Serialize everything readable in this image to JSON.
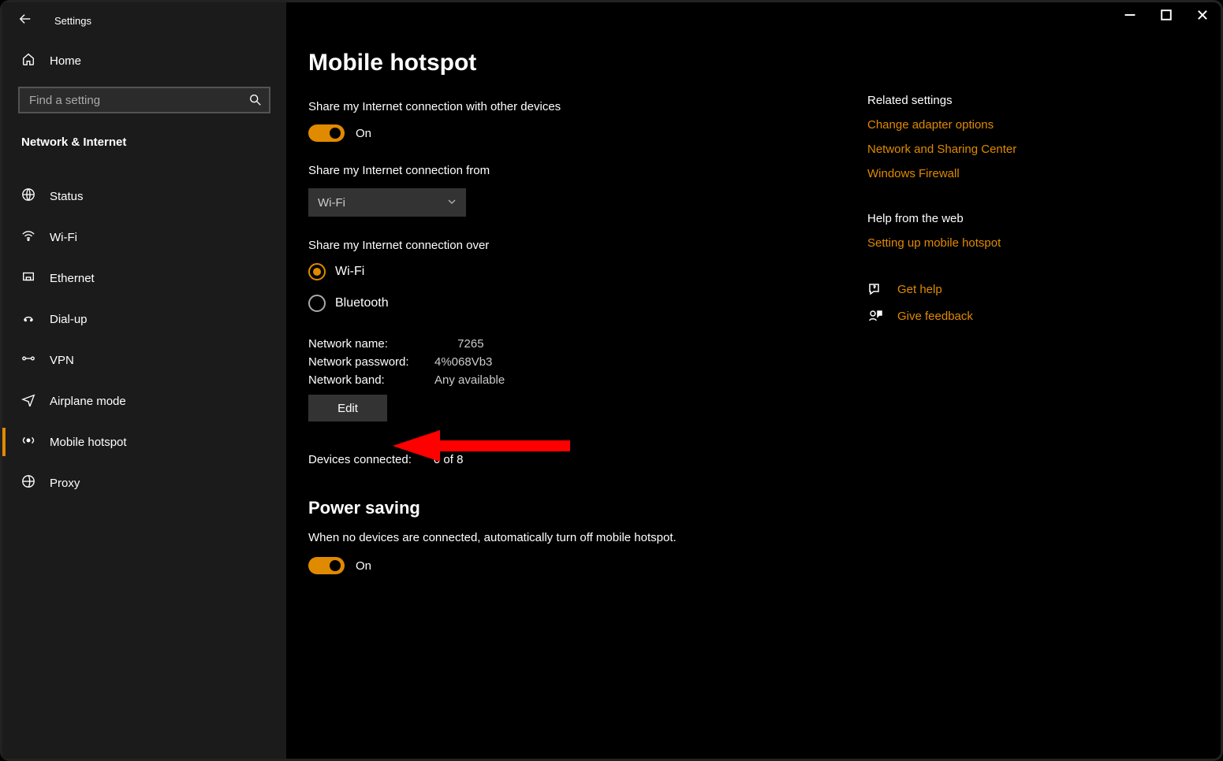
{
  "titlebar": {
    "app_name": "Settings"
  },
  "home_label": "Home",
  "search": {
    "placeholder": "Find a setting"
  },
  "section_label": "Network & Internet",
  "nav": [
    {
      "label": "Status"
    },
    {
      "label": "Wi-Fi"
    },
    {
      "label": "Ethernet"
    },
    {
      "label": "Dial-up"
    },
    {
      "label": "VPN"
    },
    {
      "label": "Airplane mode"
    },
    {
      "label": "Mobile hotspot"
    },
    {
      "label": "Proxy"
    }
  ],
  "page": {
    "title": "Mobile hotspot",
    "share_label": "Share my Internet connection with other devices",
    "share_toggle": "On",
    "from_label": "Share my Internet connection from",
    "from_value": "Wi-Fi",
    "over_label": "Share my Internet connection over",
    "over_options": {
      "wifi": "Wi-Fi",
      "bluetooth": "Bluetooth"
    },
    "network_name_label": "Network name:",
    "network_name_value": "       7265",
    "network_password_label": "Network password:",
    "network_password_value": "4%068Vb3",
    "network_band_label": "Network band:",
    "network_band_value": "Any available",
    "edit_button": "Edit",
    "devices_label": "Devices connected:",
    "devices_value": "0 of 8",
    "power_heading": "Power saving",
    "power_body": "When no devices are connected, automatically turn off mobile hotspot.",
    "power_toggle": "On"
  },
  "right": {
    "related_heading": "Related settings",
    "related_links": [
      "Change adapter options",
      "Network and Sharing Center",
      "Windows Firewall"
    ],
    "help_heading": "Help from the web",
    "help_links": [
      "Setting up mobile hotspot"
    ],
    "get_help": "Get help",
    "give_feedback": "Give feedback"
  }
}
